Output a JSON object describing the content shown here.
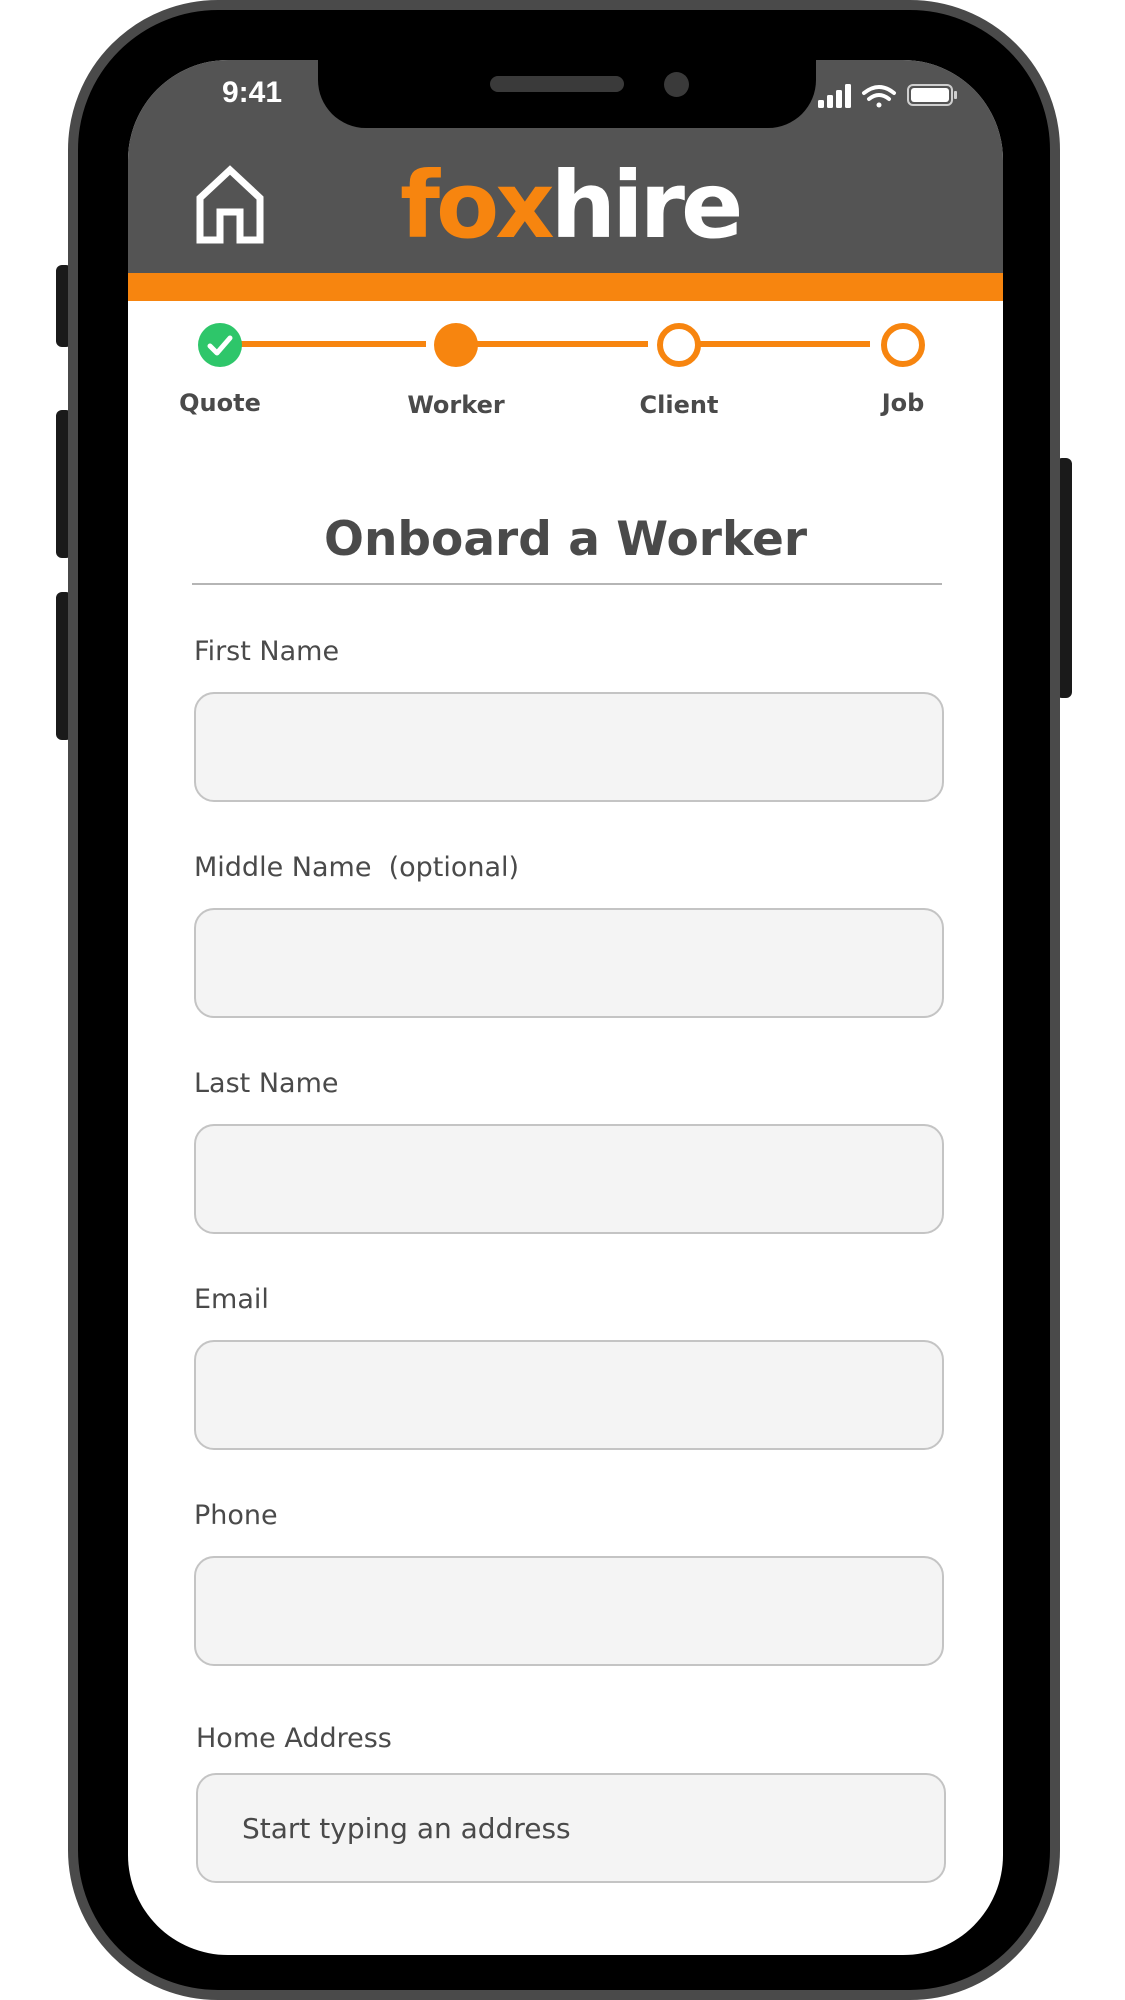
{
  "status_bar": {
    "time": "9:41"
  },
  "header": {
    "logo_part1": "fox",
    "logo_part2": "hire",
    "brand_color": "#f7850f",
    "header_color": "#545454"
  },
  "stepper": {
    "steps": [
      {
        "label": "Quote",
        "state": "completed"
      },
      {
        "label": "Worker",
        "state": "current"
      },
      {
        "label": "Client",
        "state": "upcoming"
      },
      {
        "label": "Job",
        "state": "upcoming"
      }
    ],
    "completed_color": "#2ec66a"
  },
  "form": {
    "title": "Onboard a Worker",
    "fields": [
      {
        "label": "First Name",
        "value": "",
        "placeholder": ""
      },
      {
        "label": "Middle Name  (optional)",
        "value": "",
        "placeholder": ""
      },
      {
        "label": "Last Name",
        "value": "",
        "placeholder": ""
      },
      {
        "label": "Email",
        "value": "",
        "placeholder": ""
      },
      {
        "label": "Phone",
        "value": "",
        "placeholder": ""
      },
      {
        "label": "Home Address",
        "value": "",
        "placeholder": "Start typing an address"
      }
    ]
  }
}
